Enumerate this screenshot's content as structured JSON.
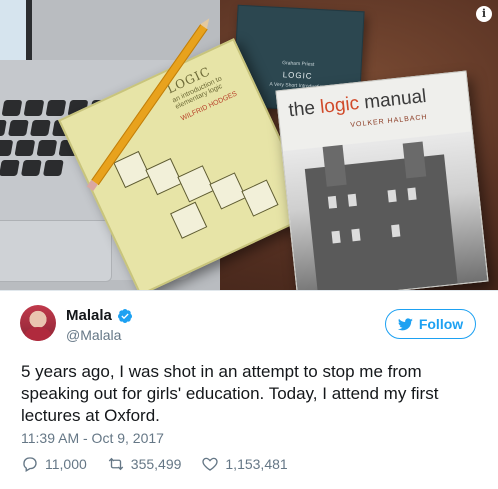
{
  "photo": {
    "info_icon": "info-icon",
    "books": {
      "logic_cover_title": "LOGIC",
      "logic_cover_subtitle": "an introduction to elementary logic",
      "logic_cover_author": "WILFRID HODGES",
      "vsi_author": "Graham Priest",
      "vsi_title": "LOGIC",
      "vsi_subtitle": "A Very Short Introduction",
      "manual_title_pre": "the ",
      "manual_title_accent": "logic",
      "manual_title_post": " manual",
      "manual_author": "VOLKER HALBACH"
    }
  },
  "user": {
    "name": "Malala",
    "handle": "@Malala",
    "verified_icon": "verified-badge-icon"
  },
  "follow_button": {
    "label": "Follow",
    "icon": "twitter-bird-icon"
  },
  "tweet": {
    "text": "5 years ago, I was shot in an attempt to stop me from speaking out for girls' education. Today, I attend my first lectures at Oxford.",
    "timestamp": "11:39 AM - Oct 9, 2017"
  },
  "actions": {
    "replies": "11,000",
    "retweets": "355,499",
    "likes": "1,153,481"
  },
  "colors": {
    "accent": "#1da1f2",
    "secondary_text": "#657786",
    "primary_text": "#14171a"
  }
}
